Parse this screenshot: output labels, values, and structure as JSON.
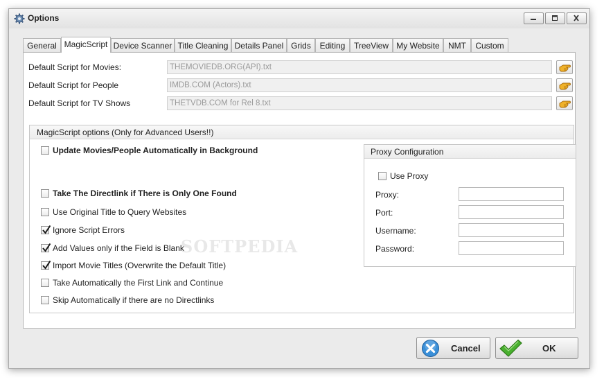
{
  "window": {
    "title": "Options"
  },
  "tabs": [
    {
      "label": "General"
    },
    {
      "label": "MagicScript"
    },
    {
      "label": "Device Scanner"
    },
    {
      "label": "Title Cleaning"
    },
    {
      "label": "Details Panel"
    },
    {
      "label": "Grids"
    },
    {
      "label": "Editing"
    },
    {
      "label": "TreeView"
    },
    {
      "label": "My Website"
    },
    {
      "label": "NMT"
    },
    {
      "label": "Custom"
    }
  ],
  "active_tab": "MagicScript",
  "scripts": {
    "movies": {
      "label": "Default Script for Movies:",
      "value": "THEMOVIEDB.ORG(API).txt"
    },
    "people": {
      "label": "Default Script for People",
      "value": "IMDB.COM (Actors).txt"
    },
    "tvshows": {
      "label": "Default Script for TV Shows",
      "value": "THETVDB.COM for Rel 8.txt"
    }
  },
  "options_group": {
    "title": "MagicScript options (Only for Advanced Users!!)",
    "checkboxes": [
      {
        "label": "Update Movies/People Automatically in Background",
        "checked": false,
        "bold": true
      },
      {
        "label": "Take The Directlink if There is Only One Found",
        "checked": false,
        "bold": true
      },
      {
        "label": "Use Original Title to Query Websites",
        "checked": false,
        "bold": false
      },
      {
        "label": "Ignore Script Errors",
        "checked": true,
        "bold": false
      },
      {
        "label": "Add Values only if the Field is Blank",
        "checked": true,
        "bold": false
      },
      {
        "label": "Import Movie Titles (Overwrite the Default Title)",
        "checked": true,
        "bold": false
      },
      {
        "label": "Take Automatically the First Link and Continue",
        "checked": false,
        "bold": false
      },
      {
        "label": "Skip Automatically if there are no Directlinks",
        "checked": false,
        "bold": false
      }
    ]
  },
  "proxy": {
    "title": "Proxy Configuration",
    "use_proxy": {
      "label": "Use Proxy",
      "checked": false
    },
    "proxy_label": "Proxy:",
    "proxy_value": "",
    "port_label": "Port:",
    "port_value": "",
    "username_label": "Username:",
    "username_value": "",
    "password_label": "Password:",
    "password_value": ""
  },
  "watermark": "SOFTPEDIA",
  "buttons": {
    "cancel": "Cancel",
    "ok": "OK"
  },
  "colors": {
    "cancel_icon": "#3a8fd8",
    "ok_icon": "#49b02f",
    "browse_icon": "#e5a21d"
  }
}
